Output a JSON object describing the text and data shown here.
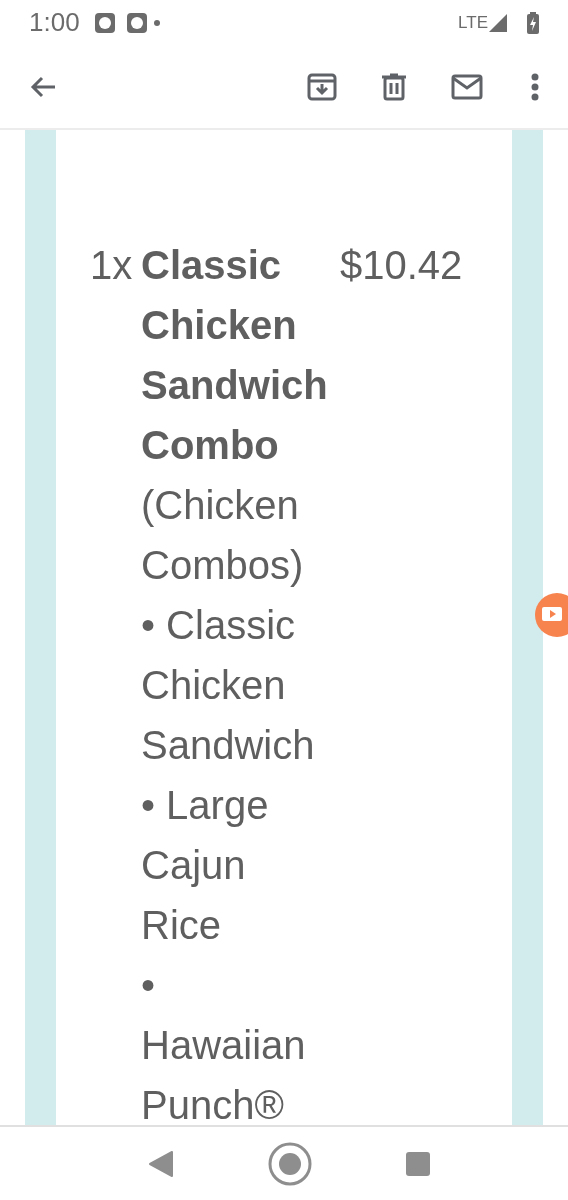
{
  "status_bar": {
    "time": "1:00",
    "network": "LTE"
  },
  "order_item": {
    "quantity": "1x",
    "name": "Classic Chicken Sandwich Combo",
    "category": "(Chicken Combos)",
    "price": "$10.42",
    "modifiers": [
      "• Classic Chicken Sandwich",
      "• Large Cajun Rice",
      "• Hawaiian Punch®"
    ]
  }
}
